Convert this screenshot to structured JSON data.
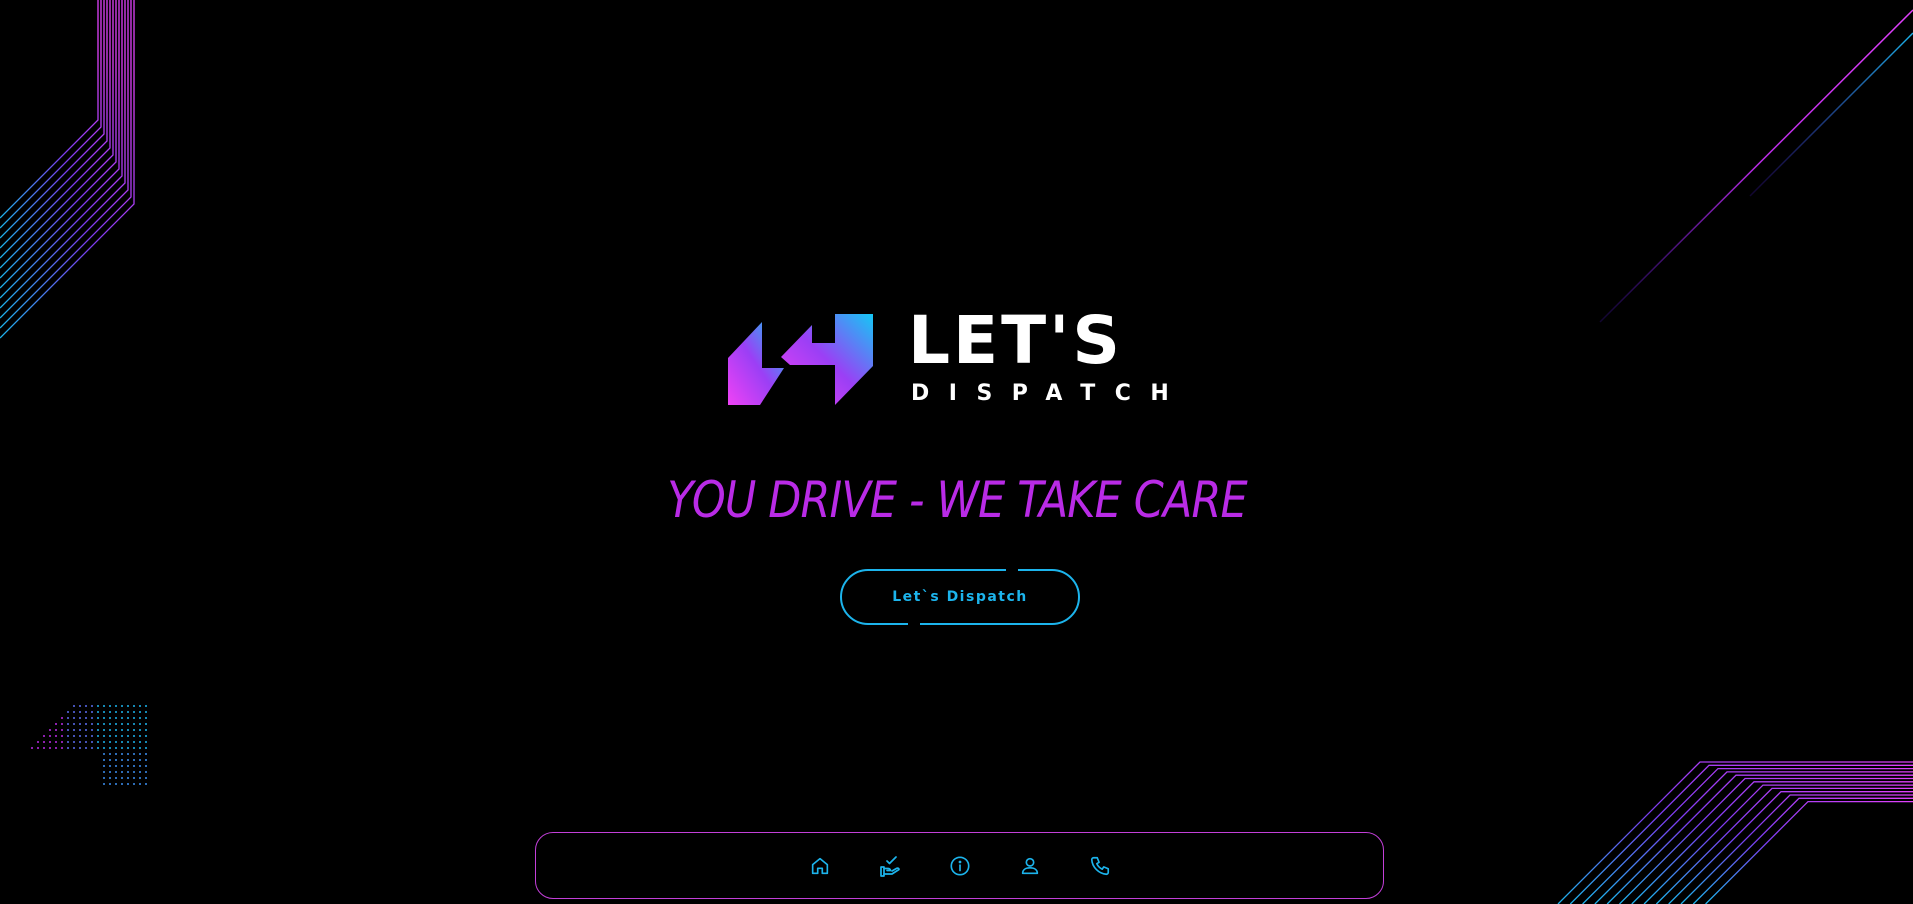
{
  "brand": {
    "name": "LET'S",
    "sub": "DISPATCH"
  },
  "hero": {
    "tagline": "YOU DRIVE - WE TAKE CARE",
    "cta_label": "Let`s Dispatch"
  },
  "bottom_nav": {
    "items": [
      {
        "icon": "home-icon"
      },
      {
        "icon": "hand-check-icon"
      },
      {
        "icon": "info-icon"
      },
      {
        "icon": "user-icon"
      },
      {
        "icon": "phone-icon"
      }
    ]
  },
  "colors": {
    "background": "#000000",
    "magenta": "#e040fb",
    "purple": "#b92be6",
    "cyan": "#1cb4ec",
    "nav_border": "#c23fd8",
    "text": "#ffffff"
  }
}
